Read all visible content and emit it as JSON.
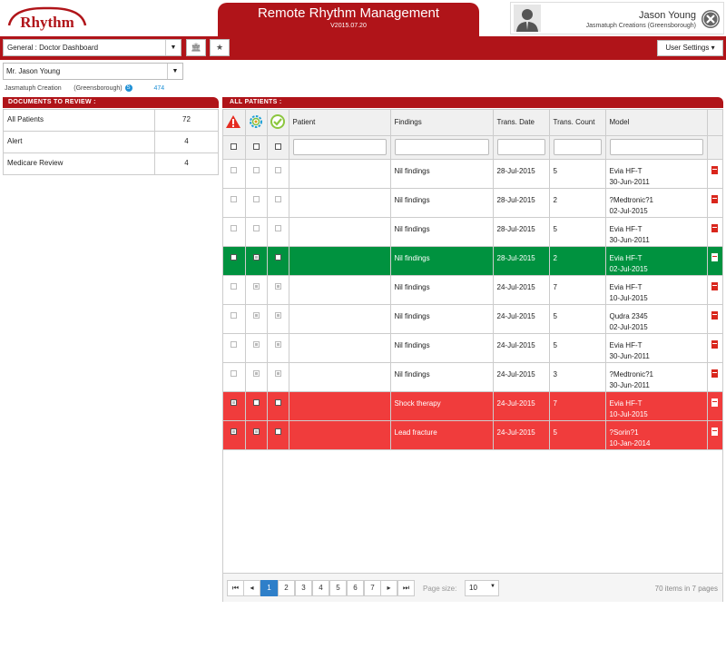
{
  "header": {
    "logo_text": "Rhythm",
    "title": "Remote Rhythm Management",
    "version": "V2015.07.20",
    "user_name": "Jason Young",
    "user_org": "Jasmatuph Creations (Greensborough)"
  },
  "toolbar": {
    "dashboard_value": "General : Doctor Dashboard",
    "user_settings_label": "User Settings ▾"
  },
  "sidebar": {
    "doctor_value": "Mr. Jason Young",
    "practice_name": "Jasmatuph Creation",
    "practice_location": "(Greensborough)",
    "practice_count": "474",
    "docs_header": "DOCUMENTS TO REVIEW :",
    "docs": [
      {
        "label": "All Patients",
        "count": "72"
      },
      {
        "label": "Alert",
        "count": "4"
      },
      {
        "label": "Medicare Review",
        "count": "4"
      }
    ]
  },
  "patients": {
    "header": "ALL PATIENTS :",
    "columns": {
      "patient": "Patient",
      "findings": "Findings",
      "trans_date": "Trans. Date",
      "trans_count": "Trans. Count",
      "model": "Model"
    },
    "rows": [
      {
        "findings": "Nil findings",
        "date": "28-Jul-2015",
        "count": "5",
        "model": "Evia HF-T",
        "model_date": "30-Jun-2011",
        "style": ""
      },
      {
        "findings": "Nil findings",
        "date": "28-Jul-2015",
        "count": "2",
        "model": "?Medtronic?1",
        "model_date": "02-Jul-2015",
        "style": ""
      },
      {
        "findings": "Nil findings",
        "date": "28-Jul-2015",
        "count": "5",
        "model": "Evia HF-T",
        "model_date": "30-Jun-2011",
        "style": ""
      },
      {
        "findings": "Nil findings",
        "date": "28-Jul-2015",
        "count": "2",
        "model": "Evia HF-T",
        "model_date": "02-Jul-2015",
        "style": "green"
      },
      {
        "findings": "Nil findings",
        "date": "24-Jul-2015",
        "count": "7",
        "model": "Evia HF-T",
        "model_date": "10-Jul-2015",
        "style": ""
      },
      {
        "findings": "Nil findings",
        "date": "24-Jul-2015",
        "count": "5",
        "model": "Qudra 2345",
        "model_date": "02-Jul-2015",
        "style": ""
      },
      {
        "findings": "Nil findings",
        "date": "24-Jul-2015",
        "count": "5",
        "model": "Evia HF-T",
        "model_date": "30-Jun-2011",
        "style": ""
      },
      {
        "findings": "Nil findings",
        "date": "24-Jul-2015",
        "count": "3",
        "model": "?Medtronic?1",
        "model_date": "30-Jun-2011",
        "style": ""
      },
      {
        "findings": "Shock therapy",
        "date": "24-Jul-2015",
        "count": "7",
        "model": "Evia HF-T",
        "model_date": "10-Jul-2015",
        "style": "red"
      },
      {
        "findings": "Lead fracture",
        "date": "24-Jul-2015",
        "count": "5",
        "model": "?Sorin?1",
        "model_date": "10-Jan-2014",
        "style": "red"
      }
    ]
  },
  "pager": {
    "pages": [
      "1",
      "2",
      "3",
      "4",
      "5",
      "6",
      "7"
    ],
    "current_page": "1",
    "page_size_label": "Page size:",
    "page_size_value": "10",
    "items_info": "70 items in 7 pages"
  },
  "colors": {
    "brand_red": "#b01419",
    "row_green": "#00923f",
    "row_red": "#f03c3c",
    "pager_active": "#2e7fc9"
  },
  "icons": [
    "alert-triangle-icon",
    "gear-badge-icon",
    "checkmark-circle-icon",
    "pdf-icon",
    "bank-icon",
    "star-icon",
    "close-icon",
    "user-avatar-icon",
    "skype-icon"
  ]
}
